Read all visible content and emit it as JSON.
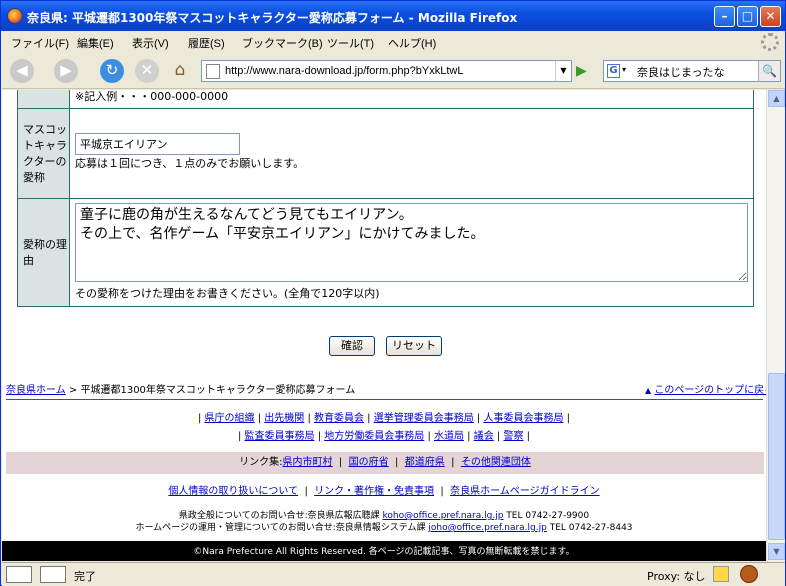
{
  "window": {
    "title": "奈良県: 平城遷都1300年祭マスコットキャラクター愛称応募フォーム - Mozilla Firefox"
  },
  "menu": {
    "file": "ファイル(F)",
    "edit": "編集(E)",
    "view": "表示(V)",
    "history": "履歴(S)",
    "bookmarks": "ブックマーク(B)",
    "tools": "ツール(T)",
    "help": "ヘルプ(H)"
  },
  "nav": {
    "url": "http://www.nara-download.jp/form.php?bYxkLtwL",
    "search_engine": "G",
    "search_query": "奈良はじまったな"
  },
  "form": {
    "phone_example": "※記入例・・・000-000-0000",
    "mascot_label": "マスコットキャラクターの愛称",
    "mascot_value": "平城京エイリアン",
    "mascot_note": "応募は１回につき、１点のみでお願いします。",
    "reason_label": "愛称の理由",
    "reason_value": "童子に鹿の角が生えるなんてどう見てもエイリアン。\nその上で、名作ゲーム「平安京エイリアン」にかけてみました。",
    "reason_note": "その愛称をつけた理由をお書きください。(全角で120字以内)",
    "confirm": "確認",
    "reset": "リセット"
  },
  "breadcrumb": {
    "home": "奈良県ホーム",
    "sep": ">",
    "current": "平城遷都1300年祭マスコットキャラクター愛称応募フォーム",
    "to_top": "このページのトップに戻る",
    "to_top_icon": "triangle-up-icon"
  },
  "links1": [
    "県庁の組織",
    "出先機関",
    "教育委員会",
    "選挙管理委員会事務局",
    "人事委員会事務局"
  ],
  "links2": [
    "監査委員事務局",
    "地方労働委員会事務局",
    "水道局",
    "議会",
    "警察"
  ],
  "linkband": {
    "prefix": "リンク集:",
    "items": [
      "県内市町村",
      "国の府省",
      "都道府県",
      "その他関連団体"
    ]
  },
  "links3": [
    "個人情報の取り扱いについて",
    "リンク・著作権・免責事項",
    "奈良県ホームページガイドライン"
  ],
  "contact": {
    "line1_text": "県政全般についてのお問い合せ:奈良県広報広聴課",
    "line1_email": "koho@office.pref.nara.lg.jp",
    "line1_tel": "TEL 0742-27-9900",
    "line2_text": "ホームページの運用・管理についてのお問い合せ:奈良県情報システム課",
    "line2_email": "joho@office.pref.nara.lg.jp",
    "line2_tel": "TEL 0742-27-8443"
  },
  "footer": "©Nara Prefecture All Rights Reserved. 各ページの記載記事、写真の無断転載を禁じます。",
  "status": {
    "text": "完了",
    "proxy": "Proxy: なし"
  }
}
